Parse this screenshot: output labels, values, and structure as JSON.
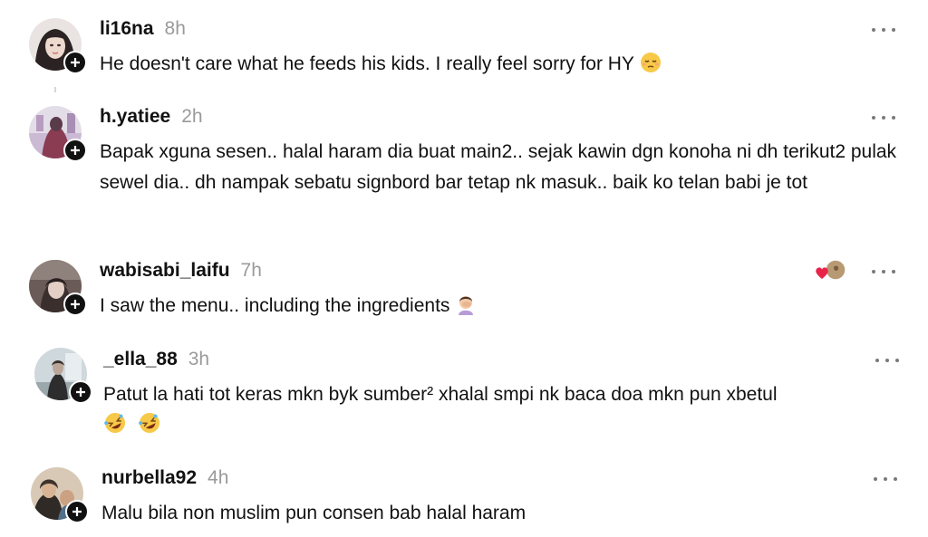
{
  "comments": [
    {
      "username": "li16na",
      "time": "8h",
      "text": "He doesn't care what he feeds his kids. I really feel sorry for HY",
      "emoji": "pensive-face",
      "avatar_icon": "user-avatar-li16na"
    },
    {
      "username": "h.yatiee",
      "time": "2h",
      "text": "Bapak xguna sesen.. halal haram dia buat main2.. sejak kawin dgn konoha ni dh terikut2 pulak sewel dia.. dh nampak sebatu signbord bar tetap nk masuk.. baik ko telan babi je tot",
      "avatar_icon": "user-avatar-h-yatiee"
    },
    {
      "username": "wabisabi_laifu",
      "time": "7h",
      "text": "I saw the menu.. including the ingredients",
      "emoji": "person-facepalming",
      "avatar_icon": "user-avatar-wabisabi-laifu",
      "reaction_icon": "liked-by-creator"
    },
    {
      "username": "_ella_88",
      "time": "3h",
      "text": "Patut la hati tot keras mkn byk sumber² xhalal smpi nk baca doa mkn pun xbetul",
      "emoji": "rolling-on-floor-laughing x2",
      "avatar_icon": "user-avatar-ella-88"
    },
    {
      "username": "nurbella92",
      "time": "4h",
      "text": "Malu bila non muslim pun consen bab halal haram",
      "avatar_icon": "user-avatar-nurbella92"
    }
  ],
  "colors": {
    "background": "#ffffff",
    "username": "#111111",
    "timestamp": "#9a9a9a",
    "text": "#111111",
    "more_dots": "#7a7a7a",
    "follow_badge": "#111111",
    "heart": "#e8244a"
  }
}
